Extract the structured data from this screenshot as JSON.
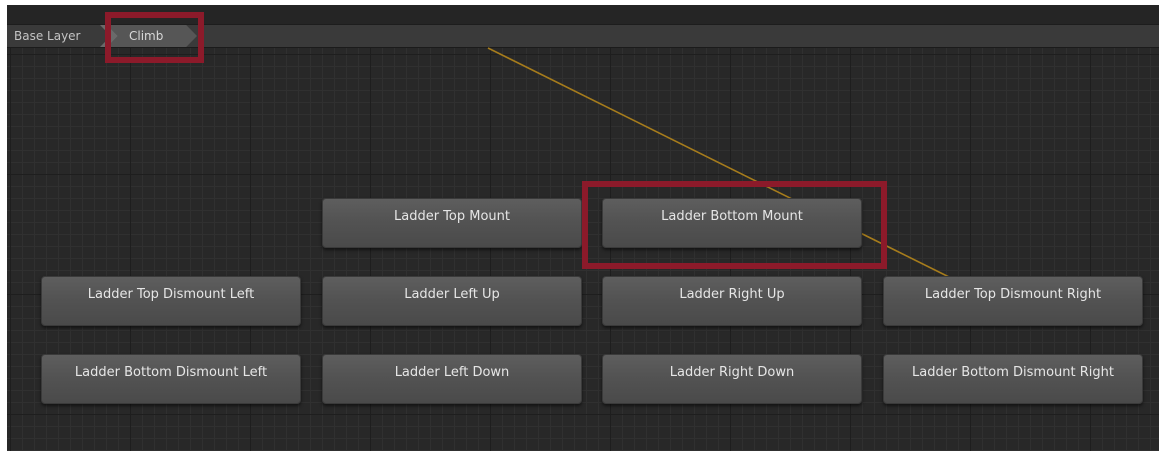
{
  "breadcrumb": {
    "base_layer": "Base Layer",
    "current": "Climb"
  },
  "colors": {
    "graph_background": "#282828",
    "node_fill": "#545454",
    "transition_line": "#a67c1c",
    "highlight": "#8c1a2a"
  },
  "states": {
    "ladder_top_mount": "Ladder Top Mount",
    "ladder_bottom_mount": "Ladder Bottom Mount",
    "ladder_top_dismount_left": "Ladder Top Dismount Left",
    "ladder_left_up": "Ladder Left Up",
    "ladder_right_up": "Ladder Right Up",
    "ladder_top_dismount_right": "Ladder Top Dismount Right",
    "ladder_bottom_dismount_left": "Ladder Bottom Dismount Left",
    "ladder_left_down": "Ladder Left Down",
    "ladder_right_down": "Ladder Right Down",
    "ladder_bottom_dismount_right": "Ladder Bottom Dismount Right"
  }
}
